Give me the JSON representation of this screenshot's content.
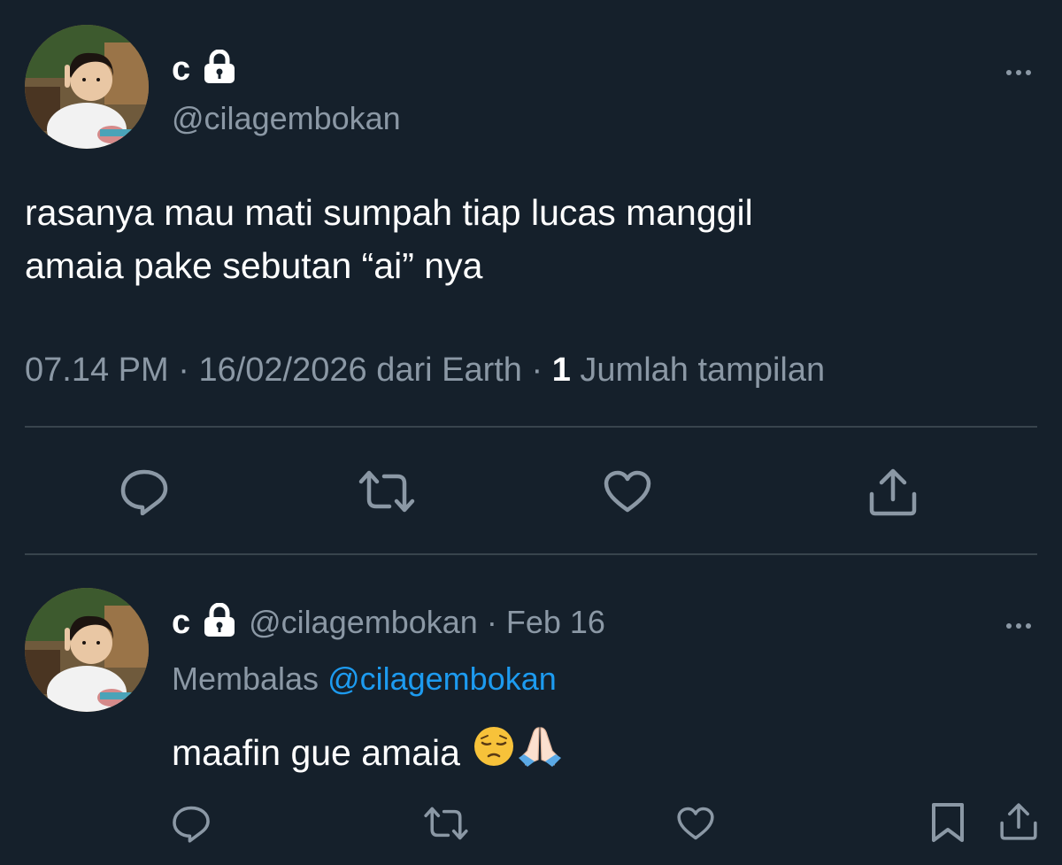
{
  "main_tweet": {
    "display_name": "c",
    "handle": "@cilagembokan",
    "text_line1": "rasanya mau mati sumpah tiap lucas manggil",
    "text_line2": "amaia pake sebutan “ai” nya",
    "time": "07.14 PM",
    "date": "16/02/2026",
    "source": "dari Earth",
    "views_count": "1",
    "views_label": "Jumlah tampilan",
    "icons": {
      "more": "more-horizontal-icon",
      "reply": "reply-icon",
      "retweet": "retweet-icon",
      "like": "like-icon",
      "share": "share-icon"
    }
  },
  "reply_tweet": {
    "display_name": "c",
    "handle": "@cilagembokan",
    "date": "Feb 16",
    "replying_label": "Membalas",
    "replying_to": "@cilagembokan",
    "text": "maafin gue amaia",
    "emojis": [
      "pensive-face",
      "folded-hands"
    ],
    "icons": {
      "reply": "reply-icon",
      "retweet": "retweet-icon",
      "like": "like-icon",
      "bookmark": "bookmark-icon",
      "share": "share-icon"
    }
  },
  "colors": {
    "background": "#15202b",
    "text": "#ffffff",
    "muted": "#8b98a5",
    "link": "#1d9bf0",
    "divider": "#38444d"
  }
}
